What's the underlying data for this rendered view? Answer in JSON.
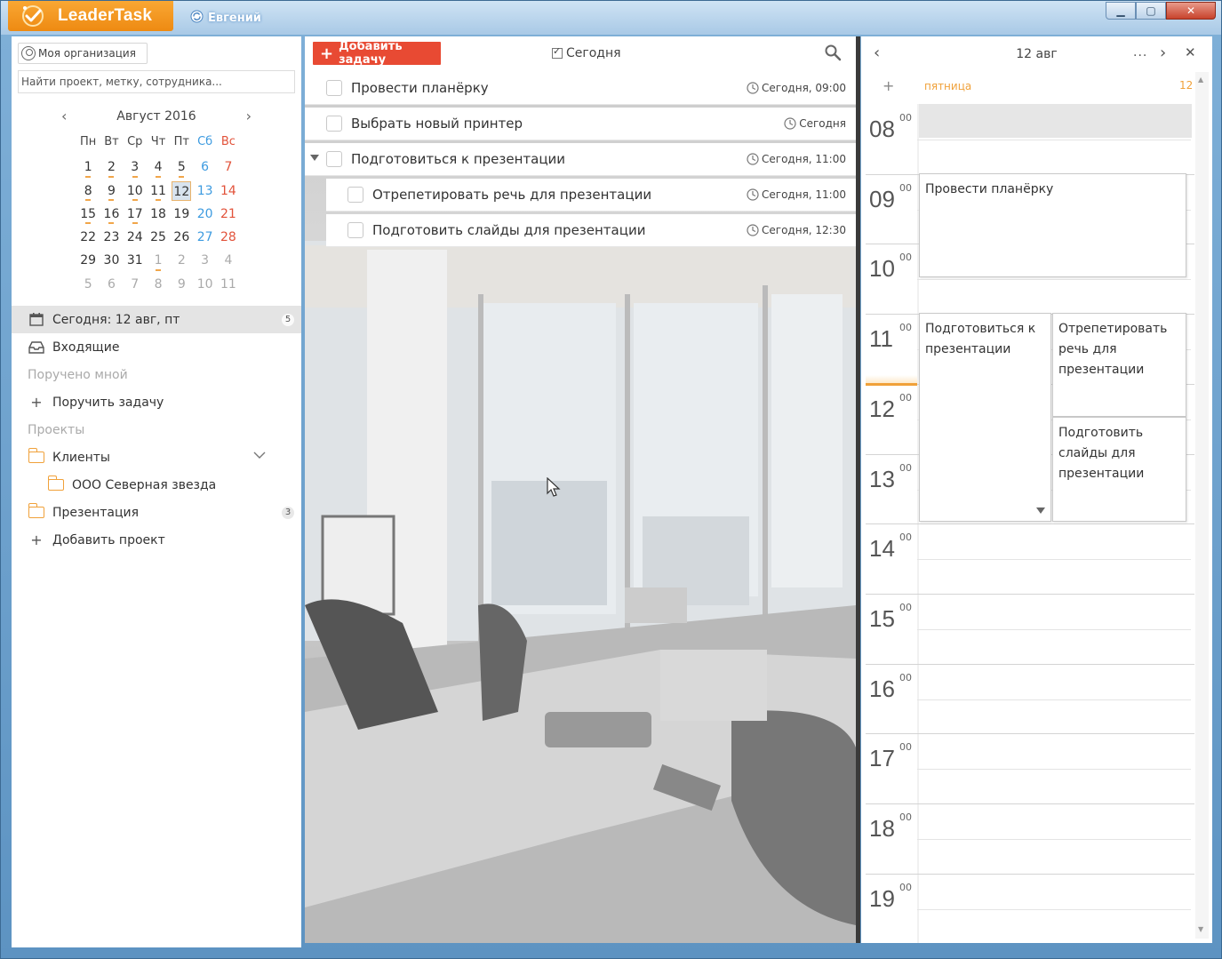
{
  "app": {
    "brand": "LeaderTask",
    "user": "Евгений",
    "colors": {
      "brand": "#ef8f17",
      "accent": "#e84a33",
      "saturday": "#3d9be0",
      "sunday": "#e2523a"
    }
  },
  "sidebar": {
    "org_button": "Моя организация",
    "search_placeholder": "Найти проект, метку, сотрудника...",
    "calendar": {
      "title": "Август 2016",
      "weekdays": [
        "Пн",
        "Вт",
        "Ср",
        "Чт",
        "Пт",
        "Сб",
        "Вс"
      ],
      "weeks": [
        [
          "1",
          "2",
          "3",
          "4",
          "5",
          "6",
          "7"
        ],
        [
          "8",
          "9",
          "10",
          "11",
          "12",
          "13",
          "14"
        ],
        [
          "15",
          "16",
          "17",
          "18",
          "19",
          "20",
          "21"
        ],
        [
          "22",
          "23",
          "24",
          "25",
          "26",
          "27",
          "28"
        ],
        [
          "29",
          "30",
          "31",
          "1",
          "2",
          "3",
          "4"
        ],
        [
          "5",
          "6",
          "7",
          "8",
          "9",
          "10",
          "11"
        ]
      ],
      "selected_day": "12"
    },
    "items": [
      {
        "label": "Сегодня: 12 авг, пт",
        "count": "5",
        "icon": "calendar-icon"
      },
      {
        "label": "Входящие",
        "icon": "inbox-icon"
      },
      {
        "label": "Поручено мной"
      },
      {
        "label": "Поручить задачу",
        "icon": "plus-icon"
      },
      {
        "label": "Проекты"
      },
      {
        "label": "Клиенты",
        "icon": "folder-icon"
      },
      {
        "label": "ООО Северная звезда",
        "icon": "folder-icon"
      },
      {
        "label": "Презентация",
        "count": "3",
        "icon": "folder-icon"
      },
      {
        "label": "Добавить проект",
        "icon": "plus-icon"
      }
    ]
  },
  "tasks": {
    "add_button": "Добавить задачу",
    "filter_label": "Сегодня",
    "rows": [
      {
        "title": "Провести планёрку",
        "due": "Сегодня, 09:00"
      },
      {
        "title": "Выбрать новый принтер",
        "due": "Сегодня"
      },
      {
        "title": "Подготовиться к презентации",
        "due": "Сегодня, 11:00"
      },
      {
        "title": "Отрепетировать речь для презентации",
        "due": "Сегодня, 11:00"
      },
      {
        "title": "Подготовить слайды для презентации",
        "due": "Сегодня, 12:30"
      }
    ]
  },
  "day": {
    "title": "12 авг",
    "more": "...",
    "weekday": "пятница",
    "daynum": "12",
    "hours": [
      "08",
      "09",
      "10",
      "11",
      "12",
      "13",
      "14",
      "15",
      "16",
      "17",
      "18",
      "19"
    ],
    "minutes": "00",
    "events": [
      {
        "title": "Провести планёрку"
      },
      {
        "title": "Подготовиться к презентации"
      },
      {
        "title": "Отрепетировать речь для презентации"
      },
      {
        "title": "Подготовить слайды для презентации"
      }
    ]
  }
}
